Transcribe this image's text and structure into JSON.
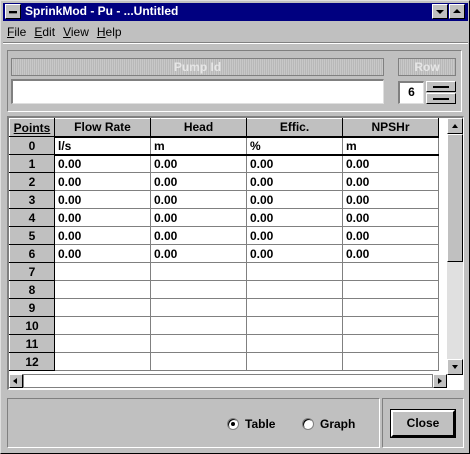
{
  "window": {
    "title": "SprinkMod - Pu - ...Untitled"
  },
  "menu": [
    {
      "label": "File",
      "mnemonic": "F",
      "rest": "ile"
    },
    {
      "label": "Edit",
      "mnemonic": "E",
      "rest": "dit"
    },
    {
      "label": "View",
      "mnemonic": "V",
      "rest": "iew"
    },
    {
      "label": "Help",
      "mnemonic": "H",
      "rest": "elp"
    }
  ],
  "pump": {
    "label": "Pump Id",
    "value": ""
  },
  "row": {
    "label": "Row",
    "value": "6"
  },
  "grid": {
    "corner": "Points",
    "columns": [
      "Flow Rate",
      "Head",
      "Effic.",
      "NPSHr"
    ],
    "units": {
      "point": "0",
      "values": [
        "l/s",
        "m",
        "%",
        "m"
      ]
    },
    "rows": [
      {
        "point": "1",
        "values": [
          "0.00",
          "0.00",
          "0.00",
          "0.00"
        ]
      },
      {
        "point": "2",
        "values": [
          "0.00",
          "0.00",
          "0.00",
          "0.00"
        ]
      },
      {
        "point": "3",
        "values": [
          "0.00",
          "0.00",
          "0.00",
          "0.00"
        ]
      },
      {
        "point": "4",
        "values": [
          "0.00",
          "0.00",
          "0.00",
          "0.00"
        ]
      },
      {
        "point": "5",
        "values": [
          "0.00",
          "0.00",
          "0.00",
          "0.00"
        ]
      },
      {
        "point": "6",
        "values": [
          "0.00",
          "0.00",
          "0.00",
          "0.00"
        ]
      },
      {
        "point": "7",
        "values": [
          "",
          "",
          "",
          ""
        ]
      },
      {
        "point": "8",
        "values": [
          "",
          "",
          "",
          ""
        ]
      },
      {
        "point": "9",
        "values": [
          "",
          "",
          "",
          ""
        ]
      },
      {
        "point": "10",
        "values": [
          "",
          "",
          "",
          ""
        ]
      },
      {
        "point": "11",
        "values": [
          "",
          "",
          "",
          ""
        ]
      },
      {
        "point": "12",
        "values": [
          "",
          "",
          "",
          ""
        ]
      }
    ]
  },
  "view_mode": {
    "options": [
      {
        "label": "Table",
        "selected": true
      },
      {
        "label": "Graph",
        "selected": false
      }
    ]
  },
  "buttons": {
    "close": "Close"
  },
  "colors": {
    "titlebar": "#000080",
    "face": "#c0c0c0"
  }
}
